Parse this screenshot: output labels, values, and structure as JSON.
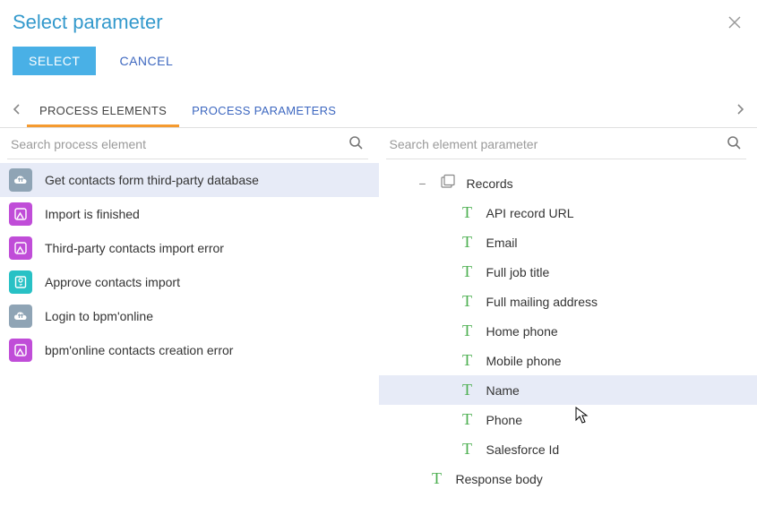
{
  "dialog": {
    "title": "Select parameter"
  },
  "actions": {
    "select": "SELECT",
    "cancel": "CANCEL"
  },
  "tabs": {
    "processElements": "PROCESS ELEMENTS",
    "processParameters": "PROCESS PARAMETERS"
  },
  "leftPanel": {
    "searchPlaceholder": "Search process element",
    "elements": [
      {
        "label": "Get contacts form third-party database",
        "icon": "cloud",
        "active": true
      },
      {
        "label": "Import is finished",
        "icon": "magenta"
      },
      {
        "label": "Third-party contacts import error",
        "icon": "magenta"
      },
      {
        "label": "Approve contacts import",
        "icon": "teal"
      },
      {
        "label": "Login to bpm'online",
        "icon": "cloud"
      },
      {
        "label": "bpm'online contacts creation error",
        "icon": "magenta"
      }
    ]
  },
  "rightPanel": {
    "searchPlaceholder": "Search element parameter",
    "groupLabel": "Records",
    "params": [
      {
        "label": "API record URL"
      },
      {
        "label": "Email"
      },
      {
        "label": "Full job title"
      },
      {
        "label": "Full mailing address"
      },
      {
        "label": "Home phone"
      },
      {
        "label": "Mobile phone"
      },
      {
        "label": "Name",
        "active": true
      },
      {
        "label": "Phone"
      },
      {
        "label": "Salesforce Id"
      }
    ],
    "responseBody": "Response body"
  }
}
